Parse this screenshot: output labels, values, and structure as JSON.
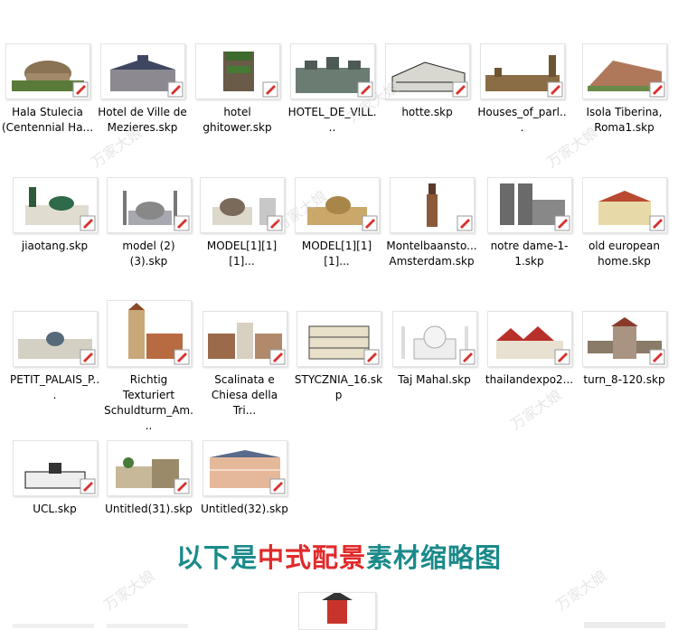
{
  "files": [
    {
      "name": "Hala Stulecia (Centennial Ha...",
      "icon": "skp-file-icon"
    },
    {
      "name": "Hotel de Ville de Mezieres.skp",
      "icon": "skp-file-icon"
    },
    {
      "name": "hotel ghitower.skp",
      "icon": "skp-file-icon"
    },
    {
      "name": "HOTEL_DE_VILL...",
      "icon": "skp-file-icon"
    },
    {
      "name": "hotte.skp",
      "icon": "skp-file-icon"
    },
    {
      "name": "Houses_of_parl...",
      "icon": "skp-file-icon"
    },
    {
      "name": "Isola Tiberina, Roma1.skp",
      "icon": "skp-file-icon"
    },
    {
      "name": "jiaotang.skp",
      "icon": "skp-file-icon"
    },
    {
      "name": "model (2) (3).skp",
      "icon": "skp-file-icon"
    },
    {
      "name": "MODEL[1][1][1]...",
      "icon": "skp-file-icon"
    },
    {
      "name": "MODEL[1][1][1]...",
      "icon": "skp-file-icon"
    },
    {
      "name": "Montelbaansto... Amsterdam.skp",
      "icon": "skp-file-icon"
    },
    {
      "name": "notre dame-1-1.skp",
      "icon": "skp-file-icon"
    },
    {
      "name": "old european home.skp",
      "icon": "skp-file-icon"
    },
    {
      "name": "PETIT_PALAIS_P...",
      "icon": "skp-file-icon"
    },
    {
      "name": "Richtig Texturiert Schuldturm_Am...",
      "icon": "skp-file-icon"
    },
    {
      "name": "Scalinata e Chiesa della Tri...",
      "icon": "skp-file-icon"
    },
    {
      "name": "STYCZNIA_16.skp",
      "icon": "skp-file-icon"
    },
    {
      "name": "Taj Mahal.skp",
      "icon": "skp-file-icon"
    },
    {
      "name": "thailandexpo2...",
      "icon": "skp-file-icon"
    },
    {
      "name": "turn_8-120.skp",
      "icon": "skp-file-icon"
    },
    {
      "name": "UCL.skp",
      "icon": "skp-file-icon"
    },
    {
      "name": "Untitled(31).skp",
      "icon": "skp-file-icon"
    },
    {
      "name": "Untitled(32).skp",
      "icon": "skp-file-icon"
    }
  ],
  "banner": {
    "part1": "以下是",
    "part2": "中式配景",
    "part3": "素材缩略图"
  },
  "watermark": "万家大娘",
  "colors": {
    "banner_teal": "#1b8a8a",
    "banner_red": "#e02a2a",
    "sketchup_red": "#d8312e"
  }
}
